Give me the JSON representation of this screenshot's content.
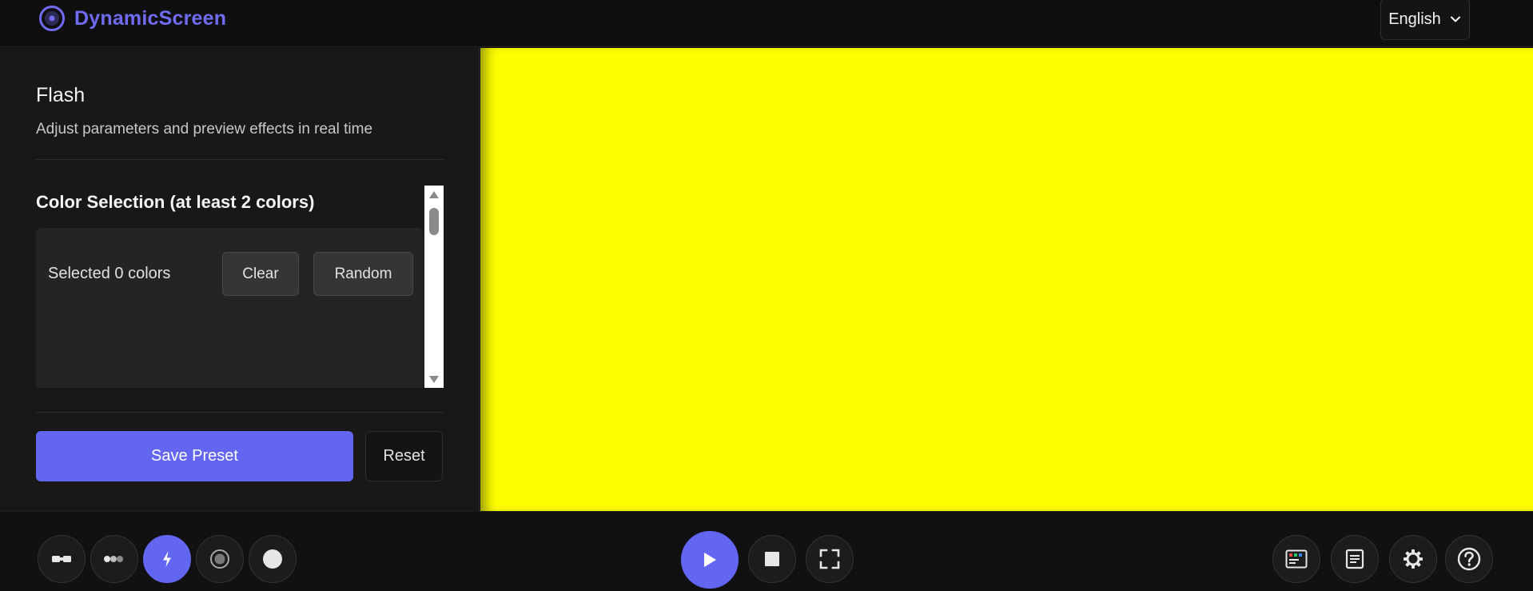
{
  "header": {
    "brand_name": "DynamicScreen",
    "language": "English"
  },
  "panel": {
    "title": "Flash",
    "subtitle": "Adjust parameters and preview effects in real time",
    "color_section": {
      "title": "Color Selection (at least 2 colors)",
      "selected_label": "Selected 0 colors",
      "clear_label": "Clear",
      "random_label": "Random"
    },
    "save_label": "Save Preset",
    "reset_label": "Reset"
  },
  "preview": {
    "color": "#ffff00"
  },
  "toolbar": {
    "modes": [
      {
        "icon": "blocks-icon",
        "active": false
      },
      {
        "icon": "dots-icon",
        "active": false
      },
      {
        "icon": "flash-icon",
        "active": true
      },
      {
        "icon": "ring-icon",
        "active": false
      },
      {
        "icon": "circle-icon",
        "active": false
      }
    ],
    "controls": [
      "play-icon",
      "stop-icon",
      "fullscreen-icon"
    ],
    "utilities": [
      "palette-window-icon",
      "document-icon",
      "gear-icon",
      "help-icon"
    ]
  },
  "colors": {
    "accent": "#6366f1",
    "brand": "#6f6cf2",
    "background": "#0f0f0f",
    "panel": "#181816"
  }
}
